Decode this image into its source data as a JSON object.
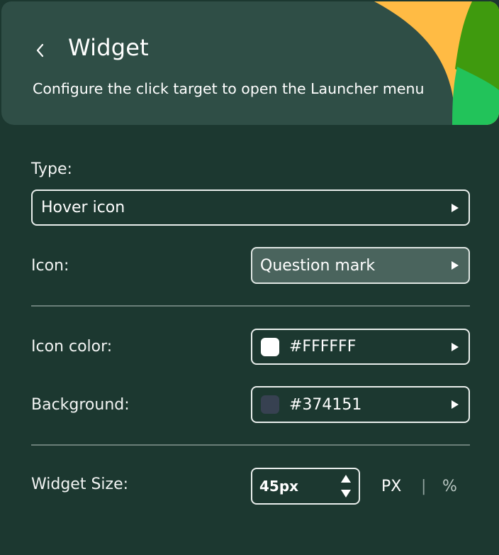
{
  "header": {
    "title": "Widget",
    "subtitle": "Configure the click target to open the Launcher menu",
    "back_icon": "chevron-left-icon",
    "accent_colors": [
      "#ffbb44",
      "#3f9a0e",
      "#22c35a"
    ]
  },
  "form": {
    "type": {
      "label": "Type:",
      "value": "Hover icon"
    },
    "icon": {
      "label": "Icon:",
      "value": "Question mark"
    },
    "icon_color": {
      "label": "Icon color:",
      "value": "#FFFFFF",
      "swatch": "#FFFFFF"
    },
    "background": {
      "label": "Background:",
      "value": "#374151",
      "swatch": "#374151"
    },
    "widget_size": {
      "label": "Widget Size:",
      "value": "45px",
      "units": {
        "px": "PX",
        "separator": "|",
        "percent": "%"
      },
      "selected_unit": "PX"
    }
  }
}
